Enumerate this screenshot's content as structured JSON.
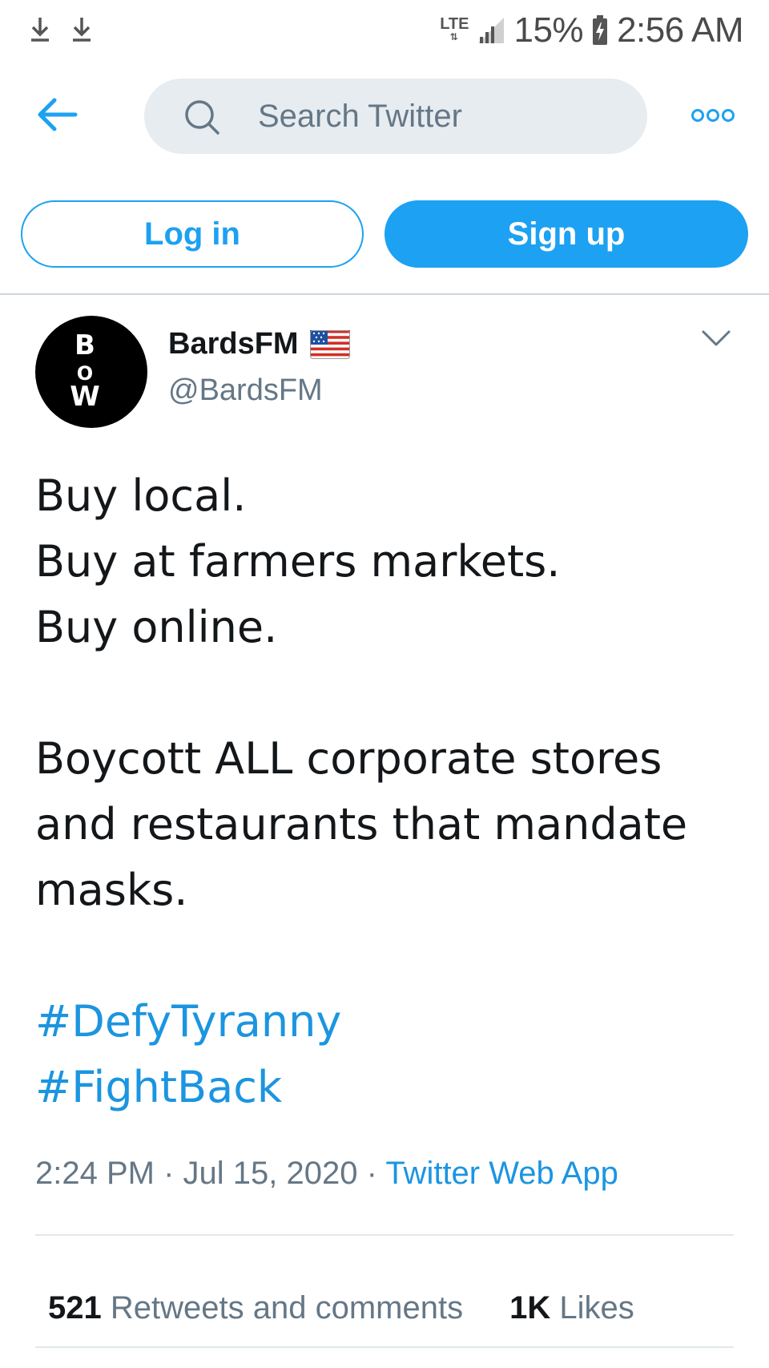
{
  "status_bar": {
    "network": "LTE",
    "battery": "15%",
    "time": "2:56 AM"
  },
  "top_bar": {
    "search_placeholder": "Search Twitter"
  },
  "auth": {
    "login_label": "Log in",
    "signup_label": "Sign up"
  },
  "tweet": {
    "display_name": "BardsFM",
    "handle": "@BardsFM",
    "avatar_text": [
      "B",
      "O",
      "W"
    ],
    "lines_block1": [
      "Buy local.",
      "Buy at farmers markets.",
      "Buy online."
    ],
    "lines_block2": [
      "Boycott ALL corporate stores",
      "and restaurants that mandate",
      "masks."
    ],
    "hashtags": [
      "#DefyTyranny",
      "#FightBack"
    ],
    "time": "2:24 PM",
    "date": "Jul 15, 2020",
    "source": "Twitter Web App",
    "retweets_count": "521",
    "retweets_label": "Retweets and comments",
    "likes_count": "1K",
    "likes_label": "Likes"
  },
  "colors": {
    "accent": "#1da1f2",
    "link": "#1b95e0",
    "muted": "#657786",
    "search_bg": "#e6ecf0"
  }
}
